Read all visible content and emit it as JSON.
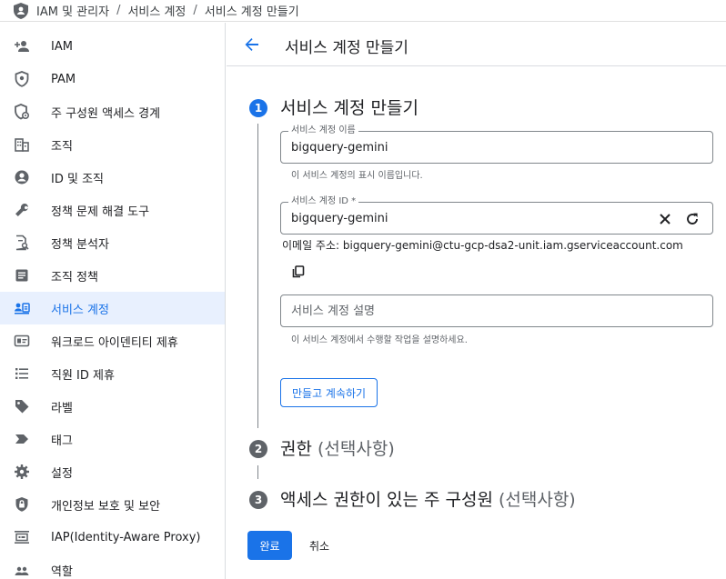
{
  "breadcrumb": {
    "items": [
      "IAM 및 관리자",
      "서비스 계정",
      "서비스 계정 만들기"
    ],
    "separator": "/"
  },
  "sidebar": {
    "items": [
      {
        "label": "IAM",
        "icon": "person-add-icon"
      },
      {
        "label": "PAM",
        "icon": "shield-icon"
      },
      {
        "label": "주 구성원 액세스 경계",
        "icon": "shield-gear-icon"
      },
      {
        "label": "조직",
        "icon": "building-icon"
      },
      {
        "label": "ID 및 조직",
        "icon": "account-circle-icon"
      },
      {
        "label": "정책 문제 해결 도구",
        "icon": "wrench-icon"
      },
      {
        "label": "정책 분석자",
        "icon": "doc-search-icon"
      },
      {
        "label": "조직 정책",
        "icon": "article-icon"
      },
      {
        "label": "서비스 계정",
        "icon": "service-account-icon",
        "active": true
      },
      {
        "label": "워크로드 아이덴티티 제휴",
        "icon": "id-card-icon"
      },
      {
        "label": "직원 ID 제휴",
        "icon": "list-icon"
      },
      {
        "label": "라벨",
        "icon": "tag-icon"
      },
      {
        "label": "태그",
        "icon": "chevron-tag-icon"
      },
      {
        "label": "설정",
        "icon": "gear-icon"
      },
      {
        "label": "개인정보 보호 및 보안",
        "icon": "privacy-shield-icon"
      },
      {
        "label": "IAP(Identity-Aware Proxy)",
        "icon": "iap-icon"
      },
      {
        "label": "역할",
        "icon": "roles-icon"
      }
    ]
  },
  "header": {
    "title": "서비스 계정 만들기"
  },
  "steps": [
    {
      "number": "1",
      "title": "서비스 계정 만들기",
      "optional": ""
    },
    {
      "number": "2",
      "title": "권한",
      "optional": "(선택사항)"
    },
    {
      "number": "3",
      "title": "액세스 권한이 있는 주 구성원",
      "optional": "(선택사항)"
    }
  ],
  "form": {
    "name_field": {
      "label": "서비스 계정 이름",
      "value": "bigquery-gemini",
      "hint": "이 서비스 계정의 표시 이름입니다."
    },
    "id_field": {
      "label": "서비스 계정 ID *",
      "value": "bigquery-gemini"
    },
    "email": "이메일 주소: bigquery-gemini@ctu-gcp-dsa2-unit.iam.gserviceaccount.com",
    "description_field": {
      "placeholder": "서비스 계정 설명",
      "value": "",
      "hint": "이 서비스 계정에서 수행할 작업을 설명하세요."
    },
    "create_continue_label": "만들고 계속하기"
  },
  "footer": {
    "done_label": "완료",
    "cancel_label": "취소"
  },
  "colors": {
    "accent": "#1a73e8",
    "active_bg": "#e8f0fe",
    "icon": "#5f6368",
    "border": "#dadce0"
  }
}
